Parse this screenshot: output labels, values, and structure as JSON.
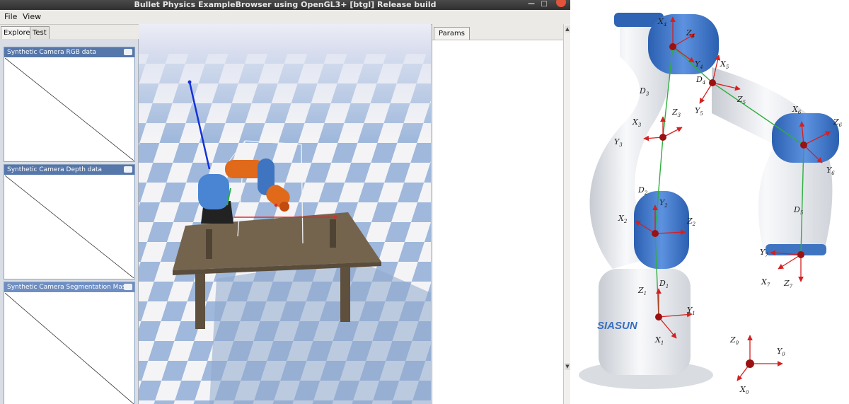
{
  "window": {
    "title": "Bullet Physics ExampleBrowser using OpenGL3+ [btgl] Release build"
  },
  "menu": [
    "File",
    "View"
  ],
  "tabs": [
    "Explorer",
    "Test"
  ],
  "camera_panels": [
    {
      "title": "Synthetic Camera RGB data"
    },
    {
      "title": "Synthetic Camera Depth data"
    },
    {
      "title": "Synthetic Camera Segmentation Mask"
    }
  ],
  "params": {
    "tab": "Params"
  },
  "diagram": {
    "brand": "SIASUN",
    "frames": [
      {
        "label": "X",
        "sub": "0"
      },
      {
        "label": "Y",
        "sub": "0"
      },
      {
        "label": "Z",
        "sub": "0"
      },
      {
        "label": "X",
        "sub": "1"
      },
      {
        "label": "Y",
        "sub": "1"
      },
      {
        "label": "Z",
        "sub": "1"
      },
      {
        "label": "X",
        "sub": "2"
      },
      {
        "label": "Y",
        "sub": "2"
      },
      {
        "label": "Z",
        "sub": "2"
      },
      {
        "label": "X",
        "sub": "3"
      },
      {
        "label": "Y",
        "sub": "3"
      },
      {
        "label": "Z",
        "sub": "3"
      },
      {
        "label": "X",
        "sub": "4"
      },
      {
        "label": "Y",
        "sub": "4"
      },
      {
        "label": "Z",
        "sub": "4"
      },
      {
        "label": "X",
        "sub": "5"
      },
      {
        "label": "Y",
        "sub": "5"
      },
      {
        "label": "Z",
        "sub": "5"
      },
      {
        "label": "X",
        "sub": "6"
      },
      {
        "label": "Y",
        "sub": "6"
      },
      {
        "label": "Z",
        "sub": "6"
      },
      {
        "label": "X",
        "sub": "7"
      },
      {
        "label": "Y",
        "sub": "7"
      },
      {
        "label": "Z",
        "sub": "7"
      }
    ],
    "links": [
      {
        "label": "D",
        "sub": "1"
      },
      {
        "label": "D",
        "sub": "2"
      },
      {
        "label": "D",
        "sub": "3"
      },
      {
        "label": "D",
        "sub": "4"
      },
      {
        "label": "D",
        "sub": "5"
      }
    ]
  },
  "colors": {
    "robot_blue": "#3f74c1",
    "robot_orange": "#e06a1a",
    "axis_red": "#d42020",
    "link_green": "#2fae3f",
    "joint_dark_red": "#8b0000",
    "floor_blue": "#9fb8db"
  }
}
